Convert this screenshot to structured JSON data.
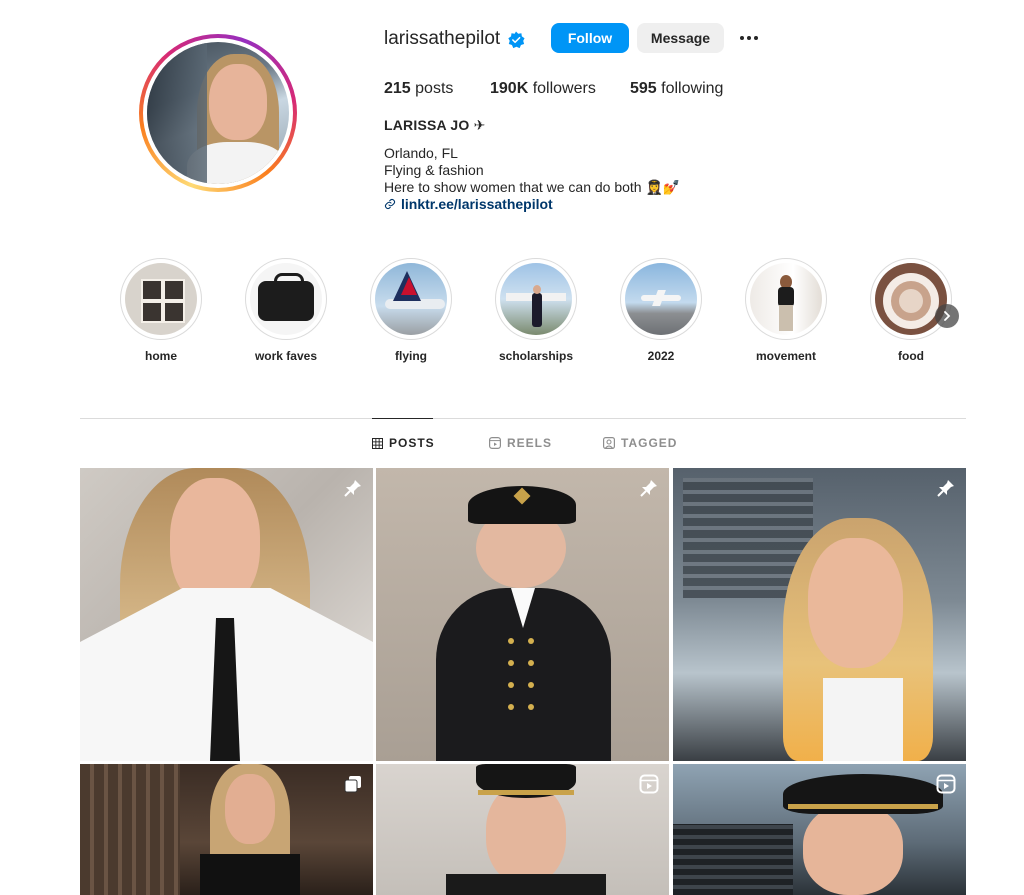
{
  "profile": {
    "username": "larissathepilot",
    "follow_label": "Follow",
    "message_label": "Message",
    "posts_count": "215",
    "posts_label": "posts",
    "followers_count": "190K",
    "followers_label": "followers",
    "following_count": "595",
    "following_label": "following",
    "full_name": "LARISSA JO ✈",
    "bio_lines": [
      "Orlando, FL",
      "Flying & fashion",
      "Here to show women that we can do both 👩‍✈️💅"
    ],
    "link": "linktr.ee/larissathepilot"
  },
  "highlights": [
    {
      "label": "home"
    },
    {
      "label": "work faves"
    },
    {
      "label": "flying"
    },
    {
      "label": "scholarships"
    },
    {
      "label": "2022"
    },
    {
      "label": "movement"
    },
    {
      "label": "food"
    }
  ],
  "tabs": [
    {
      "label": "POSTS",
      "active": true
    },
    {
      "label": "REELS",
      "active": false
    },
    {
      "label": "TAGGED",
      "active": false
    }
  ],
  "posts": [
    {
      "type": "pinned",
      "icon": "pin-icon"
    },
    {
      "type": "pinned",
      "icon": "pin-icon"
    },
    {
      "type": "pinned",
      "icon": "pin-icon"
    },
    {
      "type": "carousel",
      "icon": "carousel-icon"
    },
    {
      "type": "reel",
      "icon": "reel-icon"
    },
    {
      "type": "reel",
      "icon": "reel-icon"
    }
  ],
  "colors": {
    "accent": "#0095f6",
    "link": "#00376b",
    "verified": "#0095f6"
  }
}
